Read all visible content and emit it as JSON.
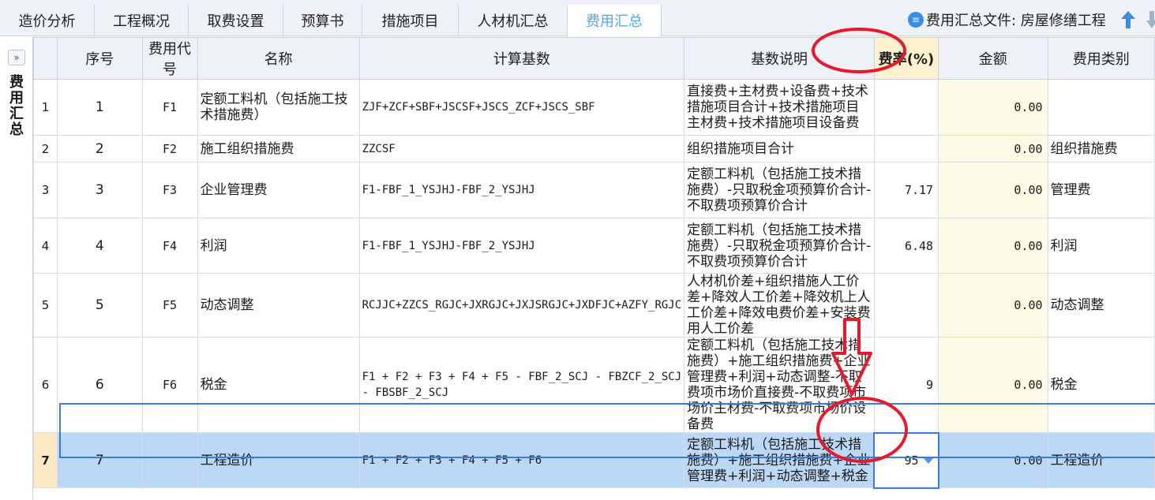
{
  "tabs": [
    {
      "label": "造价分析",
      "active": false
    },
    {
      "label": "工程概况",
      "active": false
    },
    {
      "label": "取费设置",
      "active": false
    },
    {
      "label": "预算书",
      "active": false
    },
    {
      "label": "措施项目",
      "active": false
    },
    {
      "label": "人材机汇总",
      "active": false
    },
    {
      "label": "费用汇总",
      "active": true
    }
  ],
  "file_info": {
    "label": "费用汇总文件: 房屋修缮工程",
    "icon": "document-icon"
  },
  "side_panel": {
    "expand_label": "»",
    "title": "费用汇总"
  },
  "columns": [
    "序号",
    "费用代号",
    "名称",
    "计算基数",
    "基数说明",
    "费率(%)",
    "金额",
    "费用类别"
  ],
  "rows": [
    {
      "row": "1",
      "seq": "1",
      "code": "F1",
      "name": "定额工料机（包括施工技术措施费）",
      "base": "ZJF+ZCF+SBF+JSCSF+JSCS_ZCF+JSCS_SBF",
      "desc": "直接费+主材费+设备费+技术措施项目合计+技术措施项目主材费+技术措施项目设备费",
      "rate": "",
      "amount": "0.00",
      "category": ""
    },
    {
      "row": "2",
      "seq": "2",
      "code": "F2",
      "name": "施工组织措施费",
      "base": "ZZCSF",
      "desc": "组织措施项目合计",
      "rate": "",
      "amount": "0.00",
      "category": "组织措施费"
    },
    {
      "row": "3",
      "seq": "3",
      "code": "F3",
      "name": "企业管理费",
      "base": "F1-FBF_1_YSJHJ-FBF_2_YSJHJ",
      "desc": "定额工料机（包括施工技术措施费）-只取税金项预算价合计-不取费项预算价合计",
      "rate": "7.17",
      "amount": "0.00",
      "category": "管理费"
    },
    {
      "row": "4",
      "seq": "4",
      "code": "F4",
      "name": "利润",
      "base": "F1-FBF_1_YSJHJ-FBF_2_YSJHJ",
      "desc": "定额工料机（包括施工技术措施费）-只取税金项预算价合计-不取费项预算价合计",
      "rate": "6.48",
      "amount": "0.00",
      "category": "利润"
    },
    {
      "row": "5",
      "seq": "5",
      "code": "F5",
      "name": "动态调整",
      "base": "RCJJC+ZZCS_RGJC+JXRGJC+JXJSRGJC+JXDFJC+AZFY_RGJC",
      "desc": "人材机价差+组织措施人工价差+降效人工价差+降效机上人工价差+降效电费价差+安装费用人工价差",
      "rate": "",
      "amount": "0.00",
      "category": "动态调整"
    },
    {
      "row": "6",
      "seq": "6",
      "code": "F6",
      "name": "税金",
      "base": "F1 + F2 + F3 + F4 + F5 - FBF_2_SCJ - FBZCF_2_SCJ - FBSBF_2_SCJ",
      "desc": "定额工料机（包括施工技术措施费）+施工组织措施费+企业管理费+利润+动态调整-不取费项市场价直接费-不取费项市场价主材费-不取费项市场价设备费",
      "rate": "9",
      "amount": "0.00",
      "category": "税金"
    },
    {
      "row": "7",
      "seq": "7",
      "code": "",
      "name": "工程造价",
      "base": "F1 + F2 + F3 + F4 + F5 + F6",
      "desc": "定额工料机（包括施工技术措施费）+施工组织措施费+企业管理费+利润+动态调整+税金",
      "rate": "95",
      "amount": "0.00",
      "category": "工程造价"
    }
  ],
  "selected_row": 7,
  "colors": {
    "accent": "#3a7be0",
    "active_tab_text": "#58a6ea",
    "annotation": "#e8192c",
    "selection": "#bcd8f7",
    "amount_bg": "#fdfbe6"
  }
}
